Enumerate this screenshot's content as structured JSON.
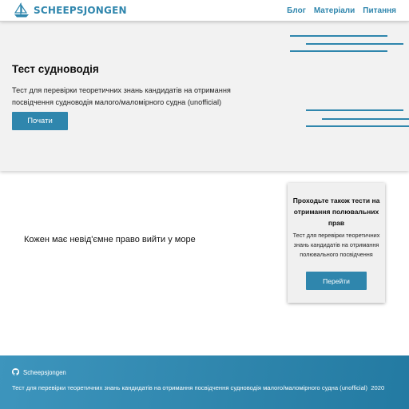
{
  "header": {
    "logo_text": "SCHEEPSJONGEN",
    "logo_icon": "sailboat-icon",
    "nav": [
      "Блог",
      "Матеріали",
      "Питання"
    ]
  },
  "hero": {
    "title": "Тест судноводія",
    "description": "Тест для перевірки теоретичних знань кандидатів на отримання посвідчення судноводія малого/маломірного судна (unofficial)",
    "start_button": "Почати"
  },
  "main": {
    "motto": "Кожен має невід'ємне право вийти у море",
    "card": {
      "title": "Проходьте також тести на отримання полювальних прав",
      "description": "Тест для перевірки теоретичних знань кандидатів на отримання полювального посвідчення",
      "button": "Перейти"
    }
  },
  "footer": {
    "github_icon": "github-icon",
    "github_label": "Scheepsjongen",
    "description": "Тест для перевірки теоретичних знань кандидатів на отримання посвідчення судноводія малого/маломірного судна (unofficial)",
    "year": "2020"
  },
  "colors": {
    "accent": "#2f86ad",
    "hero_background": "#f2f2f2",
    "card_background": "#f0f0f0"
  }
}
